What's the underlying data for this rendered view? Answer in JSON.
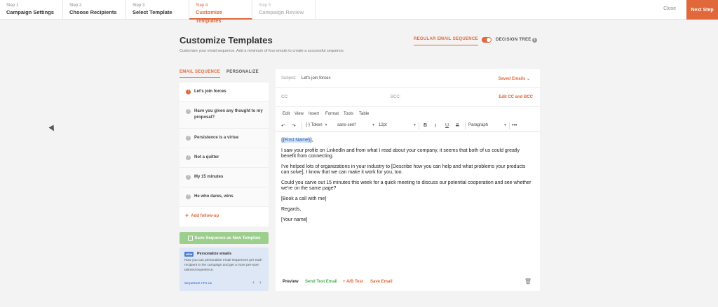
{
  "steps": [
    {
      "num": "Step 1",
      "label": "Campaign Settings"
    },
    {
      "num": "Step 2",
      "label": "Choose Recipients"
    },
    {
      "num": "Step 3",
      "label": "Select Template"
    },
    {
      "num": "Step 4",
      "label": "Customize Templates"
    },
    {
      "num": "Step 5",
      "label": "Campaign Review"
    }
  ],
  "topbar": {
    "close_label": "Close",
    "next_label": "Next Step"
  },
  "header": {
    "title": "Customize Templates",
    "subtitle": "Customize your email sequence. Add a minimum of four emails to create a successful sequence.",
    "mode_regular": "REGULAR EMAIL SEQUENCE",
    "mode_tree": "DECISION TREE"
  },
  "left": {
    "tab_sequence": "EMAIL SEQUENCE",
    "tab_personalize": "PERSONALIZE",
    "emails": [
      {
        "label": "Let's join forces"
      },
      {
        "label": "Have you given any thought to my proposal?"
      },
      {
        "label": "Persistence is a virtue"
      },
      {
        "label": "Not a quitter"
      },
      {
        "label": "My 15 minutes"
      },
      {
        "label": "He who dares, wins"
      }
    ],
    "add_followup": "Add follow-up",
    "save_template": "Save Sequence as New Template",
    "tips": {
      "badge": "NEW",
      "title": "Personalize emails",
      "body": "Now you can personalize email sequences per each recipient in the campaign and get a more per-user tailored experience.",
      "count": "SEQUENCE TIPS 1/6"
    }
  },
  "editor": {
    "subject_label": "Subject:",
    "subject_value": "Let's join forces",
    "saved_emails": "Saved Emails",
    "cc_label": "CC:",
    "bcc_label": "BCC:",
    "edit_cc": "Edit CC and BCC",
    "menu": [
      "Edit",
      "View",
      "Insert",
      "Format",
      "Tools",
      "Table"
    ],
    "toolbar": {
      "token": "Token",
      "font": "sans-serif",
      "size": "12pt",
      "block": "Paragraph"
    },
    "body": {
      "greeting_token": "{{First Name}}",
      "greeting_suffix": ",",
      "p1": "I saw your profile on LinkedIn and from what I read about your company, it seems that both of us could greatly benefit from connecting.",
      "p2": "I've helped lots of organizations in your industry to [Describe how you can help and what problems your products can solve], I know that we can make it work for you, too.",
      "p3": "Could you carve out 15 minutes this week for a quick meeting to discuss our potential cooperation and see whether we're on the same page?",
      "p4": "[Book a call with me]",
      "p5": "Regards,",
      "p6": "[Your name]"
    },
    "footer": {
      "preview": "Preview",
      "send_test": "Send Test Email",
      "ab_test": "+ A/B Test",
      "save_email": "Save Email"
    }
  }
}
